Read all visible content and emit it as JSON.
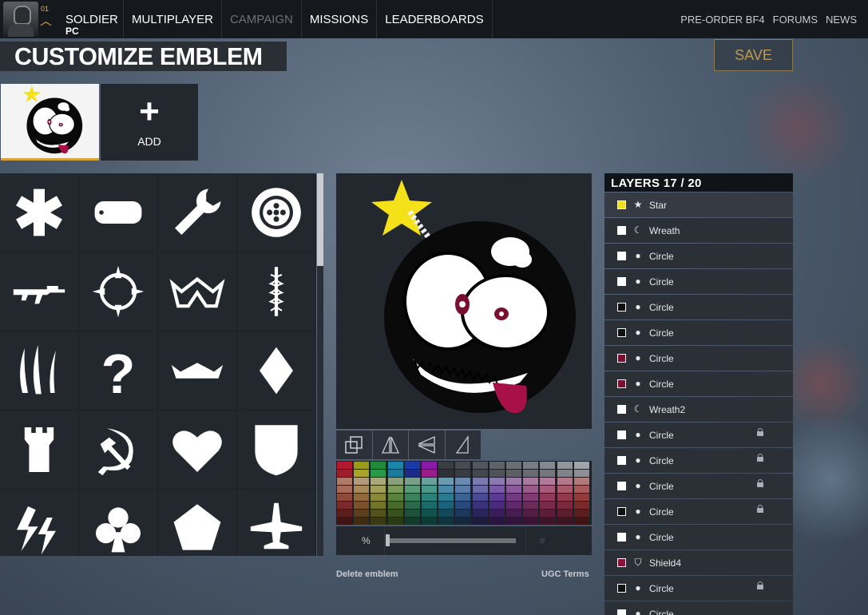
{
  "topbar": {
    "soldier_label": "SOLDIER",
    "platform": "PC",
    "rank": "01",
    "nav": [
      {
        "label": "MULTIPLAYER",
        "disabled": false
      },
      {
        "label": "CAMPAIGN",
        "disabled": true
      },
      {
        "label": "MISSIONS",
        "disabled": false
      },
      {
        "label": "LEADERBOARDS",
        "disabled": false
      }
    ],
    "right_links": [
      "PRE-ORDER BF4",
      "FORUMS",
      "NEWS"
    ]
  },
  "page": {
    "title": "CUSTOMIZE EMBLEM",
    "save_label": "SAVE",
    "add_label": "ADD"
  },
  "shapes": [
    "asterisk-icon",
    "dogtag-icon",
    "wrench-icon",
    "gear-icon",
    "rifle-icon",
    "crosshair-icon",
    "crown-icon",
    "caduceus-icon",
    "claws-icon",
    "question-mark-icon",
    "crown-flat-icon",
    "diamond-icon",
    "tower-icon",
    "hammer-sickle-icon",
    "heart-icon",
    "shield-icon",
    "lightning-icon",
    "club-icon",
    "pentagon-icon",
    "aircraft-icon"
  ],
  "editor": {
    "tools": [
      "copy-icon",
      "flip-horizontal-icon",
      "flip-vertical-icon",
      "rotate-icon"
    ],
    "opacity_symbol": "%",
    "hex_prefix": "#",
    "delete_label": "Delete emblem",
    "terms_label": "UGC Terms",
    "palette": [
      [
        "#b01a2c",
        "#9a9a1c",
        "#1f8a3a",
        "#1a86a8",
        "#1a3aa8",
        "#8a1aa8",
        "#3a3d42",
        "#474a50",
        "#53575d",
        "#5f6369",
        "#6b6f75",
        "#787c82",
        "#85898f",
        "#92969c",
        "#a0a4a8"
      ],
      [
        "#9a1e2c",
        "#a8a42a",
        "#2a9a4a",
        "#1e7a9a",
        "#1e2a8a",
        "#9a1e8a",
        "#2e3136",
        "#393c42",
        "#44484e",
        "#50545a",
        "#5c6066",
        "#686c72",
        "#74787e",
        "#80848a",
        "#8c9096"
      ],
      [
        "#b07a6a",
        "#b09a7a",
        "#a8a87a",
        "#8aa07a",
        "#7aa08a",
        "#6aa09a",
        "#6a9ab0",
        "#6a8ab0",
        "#7a7ab0",
        "#8a7ab0",
        "#9a7aa8",
        "#a87aa0",
        "#b07a9a",
        "#b07a8a",
        "#b07a7a"
      ],
      [
        "#a86a5a",
        "#a88a5a",
        "#a0a05a",
        "#7a9a5a",
        "#5a9a7a",
        "#4a9a8a",
        "#4a8aa8",
        "#5a7aa8",
        "#6a6aa8",
        "#7a5aa8",
        "#8a5a9a",
        "#9a5a8a",
        "#a85a7a",
        "#a85a6a",
        "#a85a5a"
      ],
      [
        "#904a3a",
        "#906a3a",
        "#8a8a3a",
        "#5a823a",
        "#3a825a",
        "#2a827a",
        "#2a7a92",
        "#3a6292",
        "#4a4a92",
        "#5a3a92",
        "#723a82",
        "#823a72",
        "#923a5a",
        "#923a4a",
        "#923a3a"
      ],
      [
        "#7a2a2a",
        "#7a522a",
        "#72722a",
        "#4a6a2a",
        "#2a6a4a",
        "#1a6a6a",
        "#1a627a",
        "#2a4a7a",
        "#3a327a",
        "#4a2a7a",
        "#5e2a6a",
        "#6a2a5a",
        "#7a2a4a",
        "#7a2a3a",
        "#7a2a2a"
      ],
      [
        "#5a1e1e",
        "#5a3e1e",
        "#52521e",
        "#3a521e",
        "#1e523a",
        "#12524e",
        "#12485a",
        "#1e385a",
        "#2a265a",
        "#3a1e5a",
        "#461e52",
        "#521e46",
        "#5a1e3a",
        "#5a1e2e",
        "#5a1e1e"
      ],
      [
        "#3e1414",
        "#3e2c14",
        "#3a3a14",
        "#2a3a14",
        "#143a2a",
        "#0e3a36",
        "#0e343e",
        "#14283e",
        "#1e1a3e",
        "#28143e",
        "#32143a",
        "#3a1432",
        "#3e142a",
        "#3e1420",
        "#3e1414"
      ]
    ]
  },
  "layers_panel": {
    "title": "LAYERS 17 / 20",
    "items": [
      {
        "name": "Star",
        "color": "#f0e020",
        "icon": "star-icon",
        "locked": false
      },
      {
        "name": "Wreath",
        "color": "#ffffff",
        "icon": "wreath-icon",
        "locked": false
      },
      {
        "name": "Circle",
        "color": "#ffffff",
        "icon": "circle-icon",
        "locked": false
      },
      {
        "name": "Circle",
        "color": "#ffffff",
        "icon": "circle-icon",
        "locked": false
      },
      {
        "name": "Circle",
        "color": "#111111",
        "icon": "circle-icon",
        "locked": false
      },
      {
        "name": "Circle",
        "color": "#111111",
        "icon": "circle-icon",
        "locked": false
      },
      {
        "name": "Circle",
        "color": "#7a1030",
        "icon": "circle-icon",
        "locked": false
      },
      {
        "name": "Circle",
        "color": "#7a1030",
        "icon": "circle-icon",
        "locked": false
      },
      {
        "name": "Wreath2",
        "color": "#ffffff",
        "icon": "wreath-icon",
        "locked": false
      },
      {
        "name": "Circle",
        "color": "#ffffff",
        "icon": "circle-icon",
        "locked": true
      },
      {
        "name": "Circle",
        "color": "#ffffff",
        "icon": "circle-icon",
        "locked": true
      },
      {
        "name": "Circle",
        "color": "#ffffff",
        "icon": "circle-icon",
        "locked": true
      },
      {
        "name": "Circle",
        "color": "#111111",
        "icon": "circle-icon",
        "locked": true
      },
      {
        "name": "Circle",
        "color": "#ffffff",
        "icon": "circle-icon",
        "locked": false
      },
      {
        "name": "Shield4",
        "color": "#8a1038",
        "icon": "shield-icon",
        "locked": false
      },
      {
        "name": "Circle",
        "color": "#111111",
        "icon": "circle-icon",
        "locked": true
      },
      {
        "name": "Circle",
        "color": "#ffffff",
        "icon": "circle-icon",
        "locked": false
      }
    ]
  }
}
